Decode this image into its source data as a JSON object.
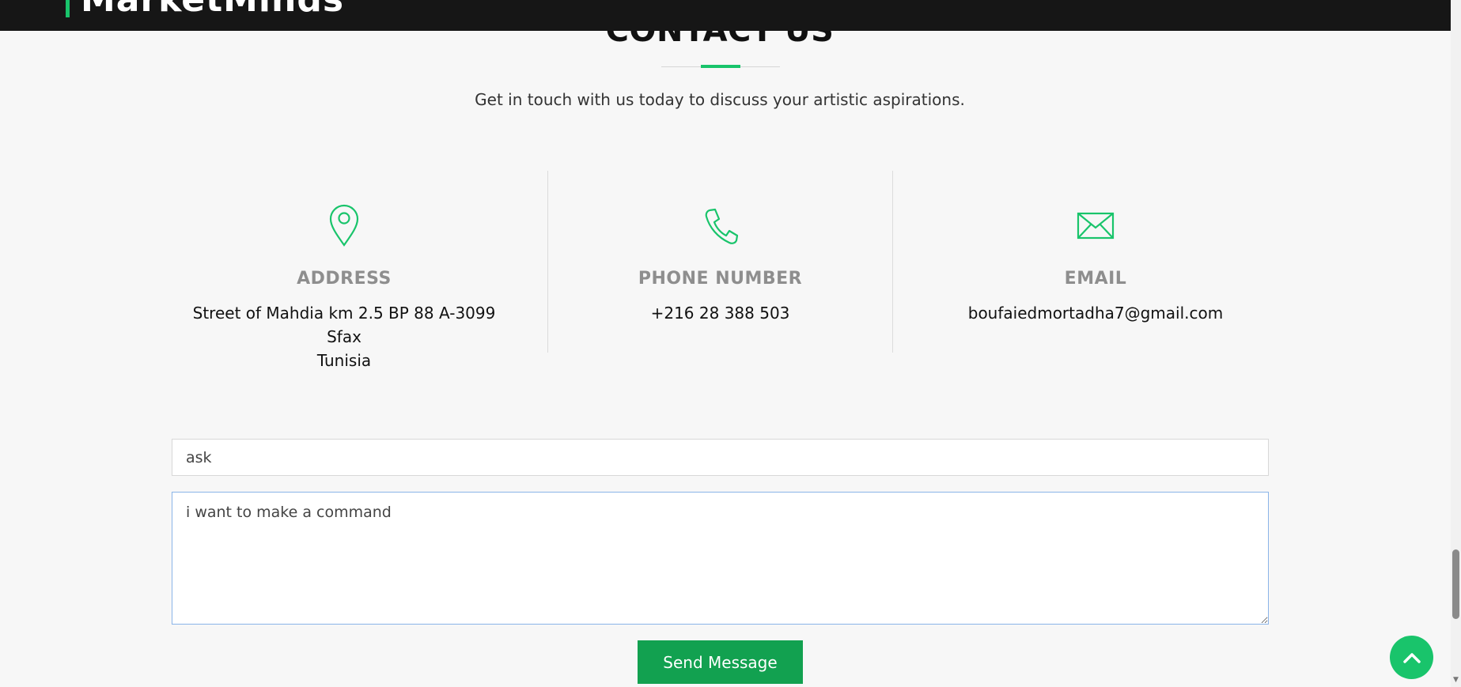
{
  "header": {
    "brand": "MarketMinds",
    "accent_color": "#19c46b"
  },
  "contact": {
    "title": "CONTACT US",
    "subtitle": "Get in touch with us today to discuss your artistic aspirations.",
    "address": {
      "icon": "map-pin-icon",
      "heading": "ADDRESS",
      "lines": [
        "Street of Mahdia km 2.5 BP 88 A-3099",
        "Sfax",
        "Tunisia"
      ]
    },
    "phone": {
      "icon": "phone-icon",
      "heading": "PHONE NUMBER",
      "value": "+216 28 388 503"
    },
    "email": {
      "icon": "envelope-icon",
      "heading": "EMAIL",
      "value": "boufaiedmortadha7@gmail.com"
    }
  },
  "form": {
    "subject_value": "ask",
    "message_value": "i want to make a command",
    "submit_label": "Send Message",
    "button_color": "#12a150"
  },
  "back_to_top": {
    "icon": "chevron-up-icon"
  }
}
